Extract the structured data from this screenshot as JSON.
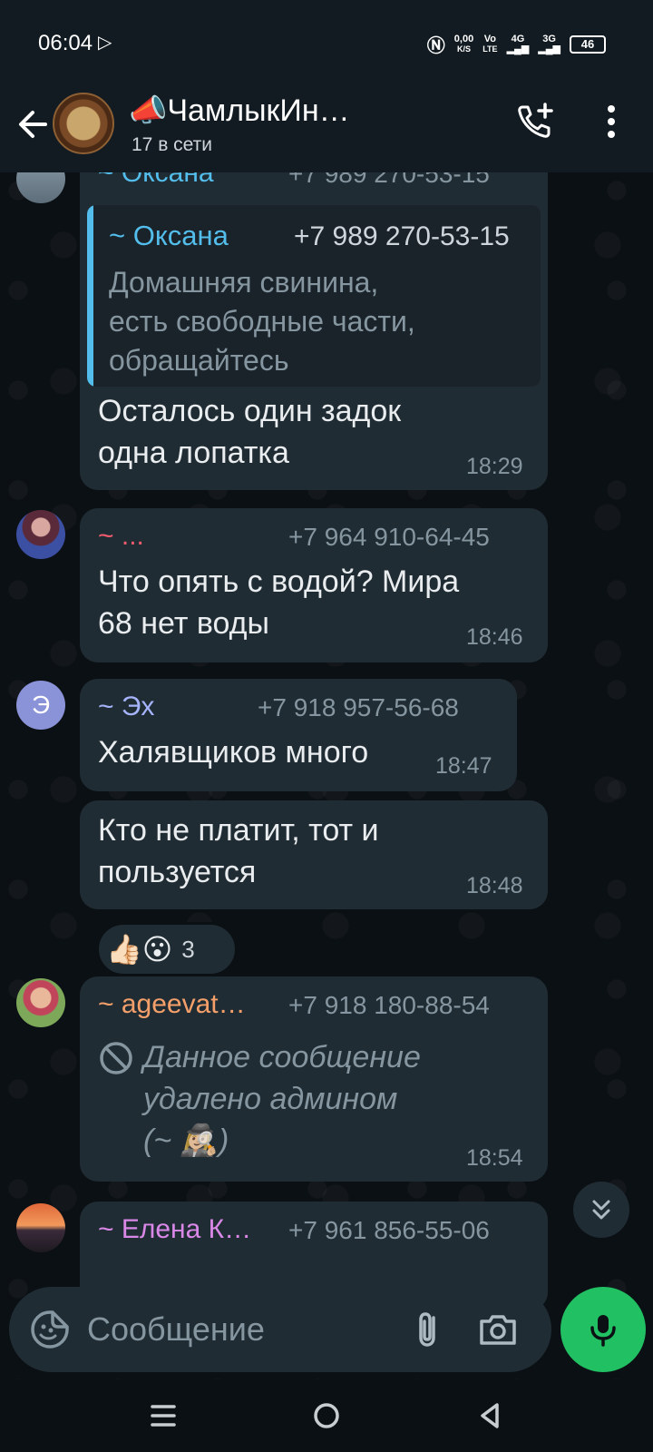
{
  "status_bar": {
    "time": "06:04",
    "net_speed_top": "0,00",
    "net_speed_bottom": "K/S",
    "volte_top": "Vo",
    "volte_bottom": "LTE",
    "net1": "4G",
    "net2": "3G",
    "battery": "46"
  },
  "header": {
    "title": "📣ЧамлыкИн…",
    "subtitle": "17 в сети"
  },
  "messages": [
    {
      "sender": "~ Оксана",
      "phone": "+7 989 270-53-15",
      "sender_color": "#53bdeb",
      "quote": {
        "sender": "~ Оксана",
        "phone": "+7 989 270-53-15",
        "lines": [
          "Домашняя свинина,",
          "есть свободные части,",
          "обращайтесь"
        ]
      },
      "lines": [
        "Осталось один задок",
        "одна лопатка"
      ],
      "time": "18:29"
    },
    {
      "sender": "~ ...",
      "phone": "+7 964 910-64-45",
      "sender_color": "#f15c6d",
      "lines": [
        "Что опять с водой? Мира",
        "68 нет воды"
      ],
      "time": "18:46"
    },
    {
      "avatar_letter": "Э",
      "sender": "~ Эх",
      "phone": "+7 918 957-56-68",
      "sender_color": "#a5b4fc",
      "lines": [
        "Халявщиков много"
      ],
      "time": "18:47"
    },
    {
      "lines": [
        "Кто не платит, тот и",
        "пользуется"
      ],
      "time": "18:48",
      "reactions": {
        "emojis": "👍🏻😮",
        "count": "3"
      }
    },
    {
      "sender": "~ ageevat…",
      "phone": "+7 918 180-88-54",
      "sender_color": "#f5a06a",
      "deleted_lines": [
        "Данное сообщение",
        "удалено админом",
        "(~ 🕵🏼‍♀️)"
      ],
      "time": "18:54"
    },
    {
      "sender": "~ Елена К…",
      "phone": "+7 961 856-55-06",
      "sender_color": "#d988e8"
    }
  ],
  "composer": {
    "placeholder": "Сообщение"
  },
  "colors": {
    "accent_green": "#21c063",
    "bubble": "#202c33",
    "background": "#0b1014"
  }
}
